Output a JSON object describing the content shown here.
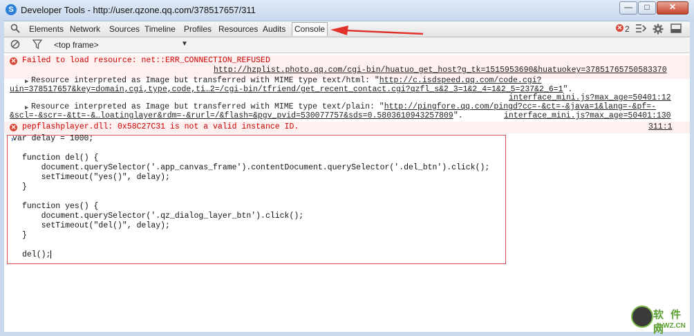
{
  "window": {
    "title": "Developer Tools - http://user.qzone.qq.com/378517657/311",
    "icon": "S",
    "controls": {
      "minimize": "—",
      "maximize": "□",
      "close": "✕"
    }
  },
  "toolbar": {
    "tabs": [
      "Elements",
      "Network",
      "Sources",
      "Timeline",
      "Profiles",
      "Resources",
      "Audits",
      "Console"
    ],
    "selected_tab": "Console",
    "error_count": "2"
  },
  "console_bar": {
    "frame_select": "<top frame>"
  },
  "messages": [
    {
      "type": "error",
      "text": "Failed to load resource: net::ERR_CONNECTION_REFUSED",
      "source": "http://hzplist.photo.qq.com/cgi-bin/huatuo_get_host?g_tk=1515953690&huatuokey=37851765750583370"
    },
    {
      "type": "warning",
      "prefix": "Resource interpreted as Image but transferred with MIME type text/html: \"",
      "url_part1": "http://c.isdspeed.qq.com/code.cgi?",
      "url_part2": "uin=378517657&key=domain,cgi,type,code,ti…2=/cgi-bin/tfriend/get_recent_contact.cgi?qzfl_s&2_3=1&2_4=1&2_5=237&2_6=1",
      "suffix": "\".",
      "source": "interface_mini.js?max_age=50401:12"
    },
    {
      "type": "warning",
      "prefix": "Resource interpreted as Image but transferred with MIME type text/plain: \"",
      "url_part1": "http://pingfore.qq.com/pingd?cc=-&ct=-&java=1&lang=-&pf=-",
      "url_part2": "&scl=-&scr=-&tt=-&…loatinglayer&rdm=-&rurl=/&flash=&pgv_pvid=530077757&sds=0.5803610943257809",
      "suffix": "\".",
      "source": "interface_mini.js?max_age=50401:130"
    },
    {
      "type": "error",
      "text": "pepflashplayer.dll: 0x58C27C31 is not a valid instance ID.",
      "source": "311:1"
    }
  ],
  "prompt_symbol": "›",
  "code": [
    "var delay = 1000;",
    "",
    "function del() {",
    "    document.querySelector('.app_canvas_frame').contentDocument.querySelector('.del_btn').click();",
    "    setTimeout(\"yes()\", delay);",
    "}",
    "",
    "function yes() {",
    "    document.querySelector('.qz_dialog_layer_btn').click();",
    "    setTimeout(\"del()\", delay);",
    "}",
    "",
    "del();"
  ],
  "watermark": {
    "text": "软 件 网",
    "url": "JLWZ.CN"
  },
  "colors": {
    "error": "#cc0000",
    "annotation": "#e0332b",
    "prompt": "#2a6cc7"
  }
}
